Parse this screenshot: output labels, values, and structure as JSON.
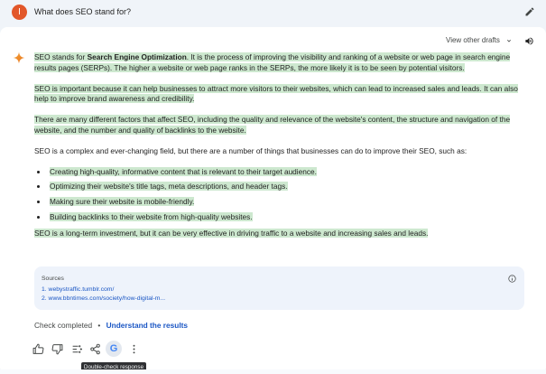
{
  "prompt": {
    "avatar_letter": "I",
    "text": "What does SEO stand for?"
  },
  "header": {
    "drafts_label": "View other drafts"
  },
  "response": {
    "p1_pre": "SEO stands for ",
    "p1_bold": "Search Engine Optimization",
    "p1_post": ". It is the process of improving the visibility and ranking of a website or web page in search engine results pages (SERPs). The higher a website or web page ranks in the SERPs, the more likely it is to be seen by potential visitors.",
    "p2": "SEO is important because it can help businesses to attract more visitors to their websites, which can lead to increased sales and leads. It can also help to improve brand awareness and credibility.",
    "p3": "There are many different factors that affect SEO, including the quality and relevance of the website's content, the structure and navigation of the website, and the number and quality of backlinks to the website.",
    "p4": "SEO is a complex and ever-changing field, but there are a number of things that businesses can do to improve their SEO, such as:",
    "bullets": [
      "Creating high-quality, informative content that is relevant to their target audience.",
      "Optimizing their website's title tags, meta descriptions, and header tags.",
      "Making sure their website is mobile-friendly.",
      "Building backlinks to their website from high-quality websites."
    ],
    "p5": "SEO is a long-term investment, but it can be very effective in driving traffic to a website and increasing sales and leads."
  },
  "sources": {
    "title": "Sources",
    "links": [
      "1. webystraffic.tumblr.com/",
      "2. www.bbntimes.com/society/how-digital-m..."
    ]
  },
  "check": {
    "status": "Check completed",
    "separator": "•",
    "link": "Understand the results"
  },
  "actions": {
    "google_letter": "G",
    "tooltip": "Double-check response"
  },
  "colors": {
    "highlight": "#cde8cf",
    "link": "#1a56c4",
    "avatar": "#e2572a"
  }
}
